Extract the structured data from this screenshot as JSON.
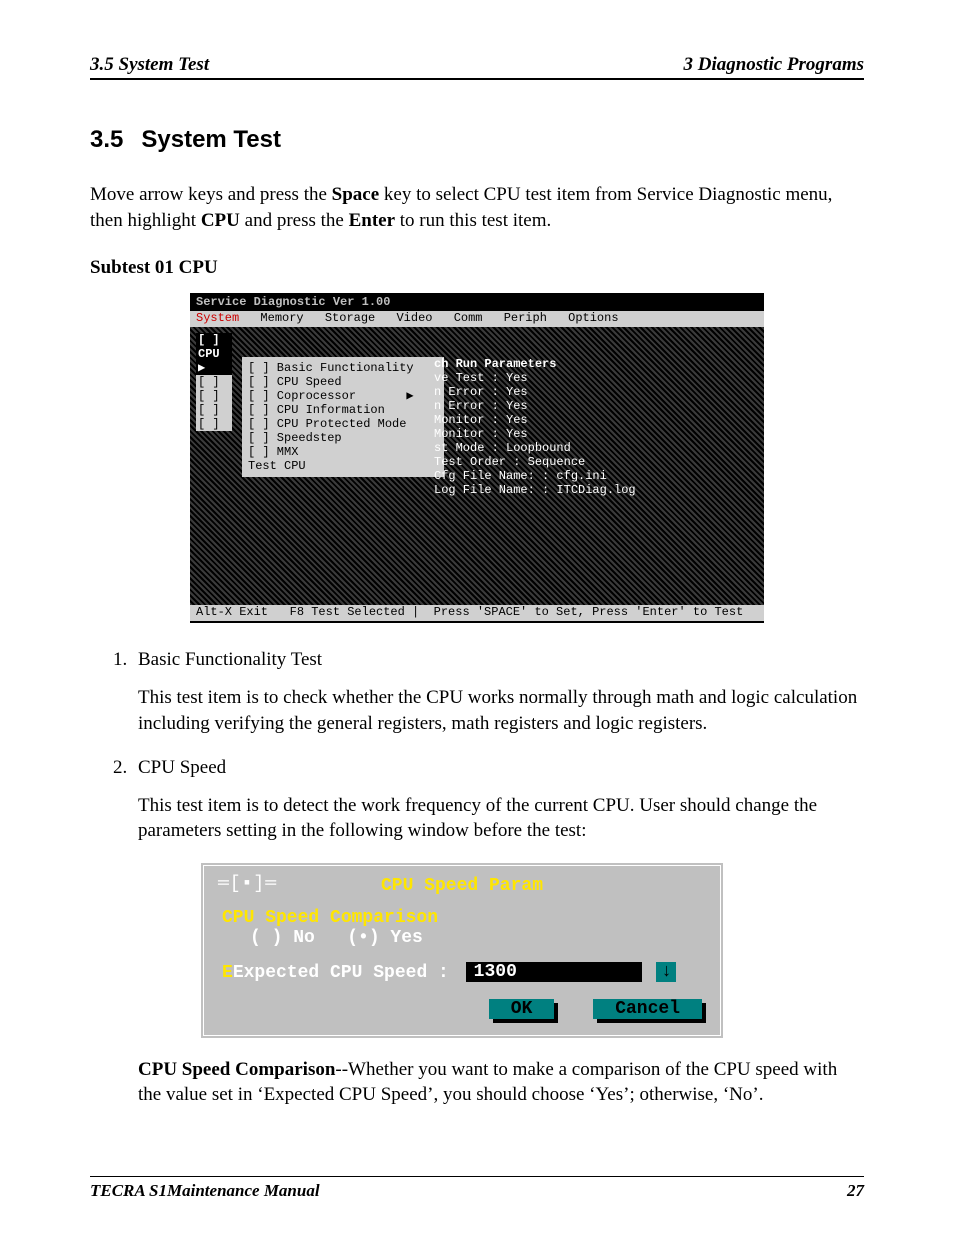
{
  "header": {
    "left": "3.5 System Test",
    "right": "3  Diagnostic Programs"
  },
  "section": {
    "number": "3.5",
    "title": "System Test"
  },
  "intro": {
    "t1": "Move arrow keys and press the ",
    "b1": "Space",
    "t2": " key to select CPU test item from Service Diagnostic menu, then highlight ",
    "b2": "CPU",
    "t3": " and press the ",
    "b3": "Enter",
    "t4": " to run this test item."
  },
  "subtest": "Subtest 01 CPU",
  "bios": {
    "title": "Service Diagnostic Ver 1.00",
    "menu": [
      "System",
      "Memory",
      "Storage",
      "Video",
      "Comm",
      "Periph",
      "Options"
    ],
    "left": [
      "[ ] CPU     ▶",
      "[ ]",
      "[ ]",
      "[ ]",
      "[ ]"
    ],
    "leftSel": 0,
    "cpu": [
      "[ ] Basic Functionality",
      "[ ] CPU Speed",
      "[ ] Coprocessor       ▶",
      "[ ] CPU Information",
      "[ ] CPU Protected Mode",
      "[ ] Speedstep",
      "[ ] MMX",
      "",
      "Test CPU"
    ],
    "paramsTitle": "ch Run Parameters",
    "params": [
      "ve Test : Yes",
      "n Error : Yes",
      "n Error : Yes",
      "",
      "Monitor : Yes",
      "Monitor : Yes",
      "",
      "st Mode : Loopbound",
      "Test Order : Sequence",
      "",
      "Cfg File Name: : cfg.ini",
      "Log File Name: : ITCDiag.log"
    ],
    "status": "Alt-X Exit   F8 Test Selected |  Press 'SPACE' to Set, Press 'Enter' to Test"
  },
  "items": [
    {
      "title": "Basic Functionality Test",
      "text": "This test item is to check whether the CPU works normally through math and logic calculation including verifying the general registers, math registers and logic registers."
    },
    {
      "title": "CPU Speed",
      "text": "This test item is to detect the work frequency of the current CPU. User should change the parameters setting in the following window before the test:"
    }
  ],
  "dlg": {
    "close": "═[▪]═",
    "title": "CPU Speed Param",
    "label1": "CPU Speed Comparison",
    "optNo": "( ) No",
    "optYes": "(•) Yes",
    "label2": "Expected CPU Speed :",
    "value": "1300",
    "spin": "↓",
    "ok": "OK",
    "cancel": "Cancel"
  },
  "postdlg": {
    "b": "CPU Speed Comparison",
    "t": "--Whether you want to make a comparison of the CPU speed with the value set in ‘Expected CPU Speed’, you should choose ‘Yes’; otherwise, ‘No’."
  },
  "footer": {
    "left": "TECRA S1Maintenance Manual",
    "right": "27"
  }
}
